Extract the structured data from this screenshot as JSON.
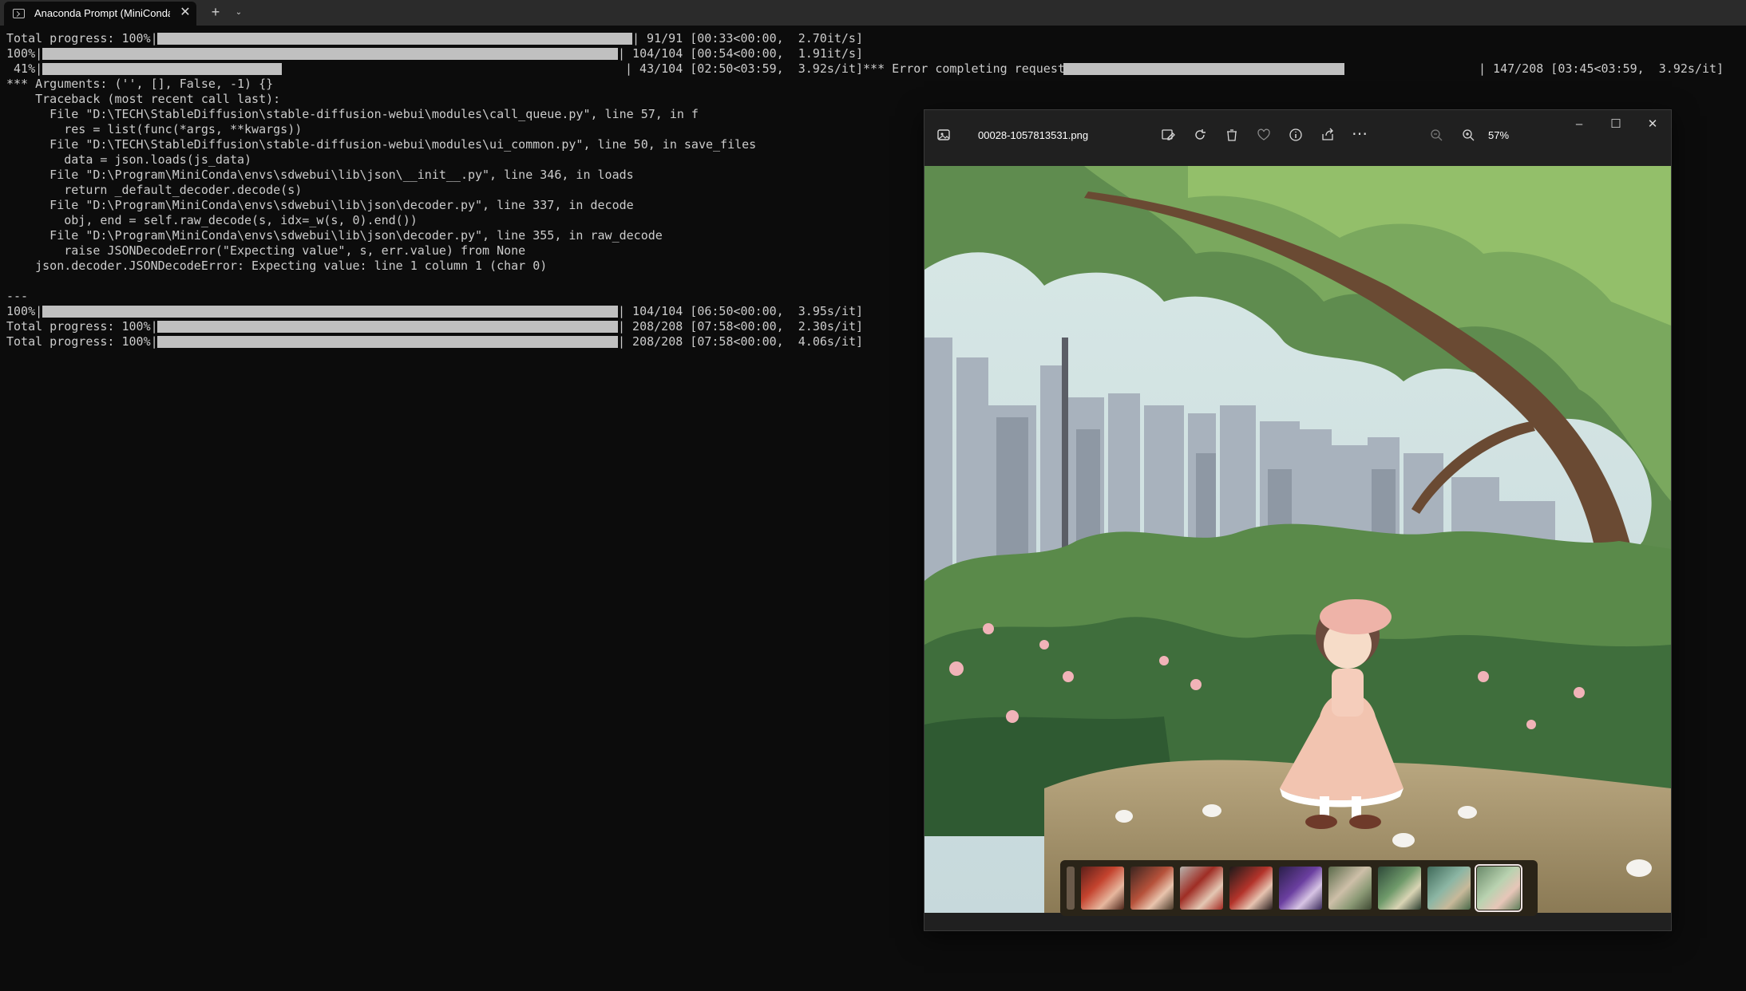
{
  "terminal_tab": {
    "title": "Anaconda Prompt (MiniConda)",
    "close_icon": "close-icon",
    "new_tab_icon": "plus-icon",
    "dropdown_icon": "chevron-down-icon"
  },
  "terminal_lines": [
    "Total progress: 100%|",
    "| 91/91 [00:33<00:00,  2.70it/s]",
    "100%|",
    "| 104/104 [00:54<00:00,  1.91it/s]",
    " 41%|",
    "| 43/104 [02:50<03:59,  3.92s/it]*** Error completing request",
    "| 147/208 [03:45<03:59,  3.92s/it]",
    "*** Arguments: ('', [], False, -1) {}",
    "    Traceback (most recent call last):",
    "      File \"D:\\TECH\\StableDiffusion\\stable-diffusion-webui\\modules\\call_queue.py\", line 57, in f",
    "        res = list(func(*args, **kwargs))",
    "      File \"D:\\TECH\\StableDiffusion\\stable-diffusion-webui\\modules\\ui_common.py\", line 50, in save_files",
    "        data = json.loads(js_data)",
    "      File \"D:\\Program\\MiniConda\\envs\\sdwebui\\lib\\json\\__init__.py\", line 346, in loads",
    "        return _default_decoder.decode(s)",
    "      File \"D:\\Program\\MiniConda\\envs\\sdwebui\\lib\\json\\decoder.py\", line 337, in decode",
    "        obj, end = self.raw_decode(s, idx=_w(s, 0).end())",
    "      File \"D:\\Program\\MiniConda\\envs\\sdwebui\\lib\\json\\decoder.py\", line 355, in raw_decode",
    "        raise JSONDecodeError(\"Expecting value\", s, err.value) from None",
    "    json.decoder.JSONDecodeError: Expecting value: line 1 column 1 (char 0)",
    "---",
    "100%|",
    "| 104/104 [06:50<00:00,  3.95s/it]",
    "Total progress: 100%|",
    "| 208/208 [07:58<00:00,  2.30s/it]",
    "Total progress: 100%|",
    "| 208/208 [07:58<00:00,  4.06s/it]"
  ],
  "progress": {
    "bar1": 1.0,
    "bar2": 1.0,
    "bar3": 0.41,
    "bar3b": 0.707,
    "bar4": 1.0,
    "bar5": 1.0,
    "bar6": 1.0
  },
  "viewer": {
    "file_name": "00028-1057813531.png",
    "zoom": "57%",
    "app_icon": "photos-icon",
    "toolbar_icons": [
      "edit-icon",
      "rotate-icon",
      "delete-icon",
      "favorite-icon",
      "info-icon",
      "share-icon",
      "more-icon"
    ],
    "zoom_icons": [
      "zoom-out-icon",
      "zoom-in-icon"
    ],
    "window_icons": [
      "minimize-icon",
      "maximize-icon",
      "close-icon"
    ],
    "thumbnail_count": 9,
    "selected_thumbnail": 9
  },
  "colors": {
    "terminal_bg": "#0c0c0c",
    "terminal_text": "#cccccc",
    "progress_fill": "#c0c0c0",
    "viewer_bg": "#202020"
  }
}
